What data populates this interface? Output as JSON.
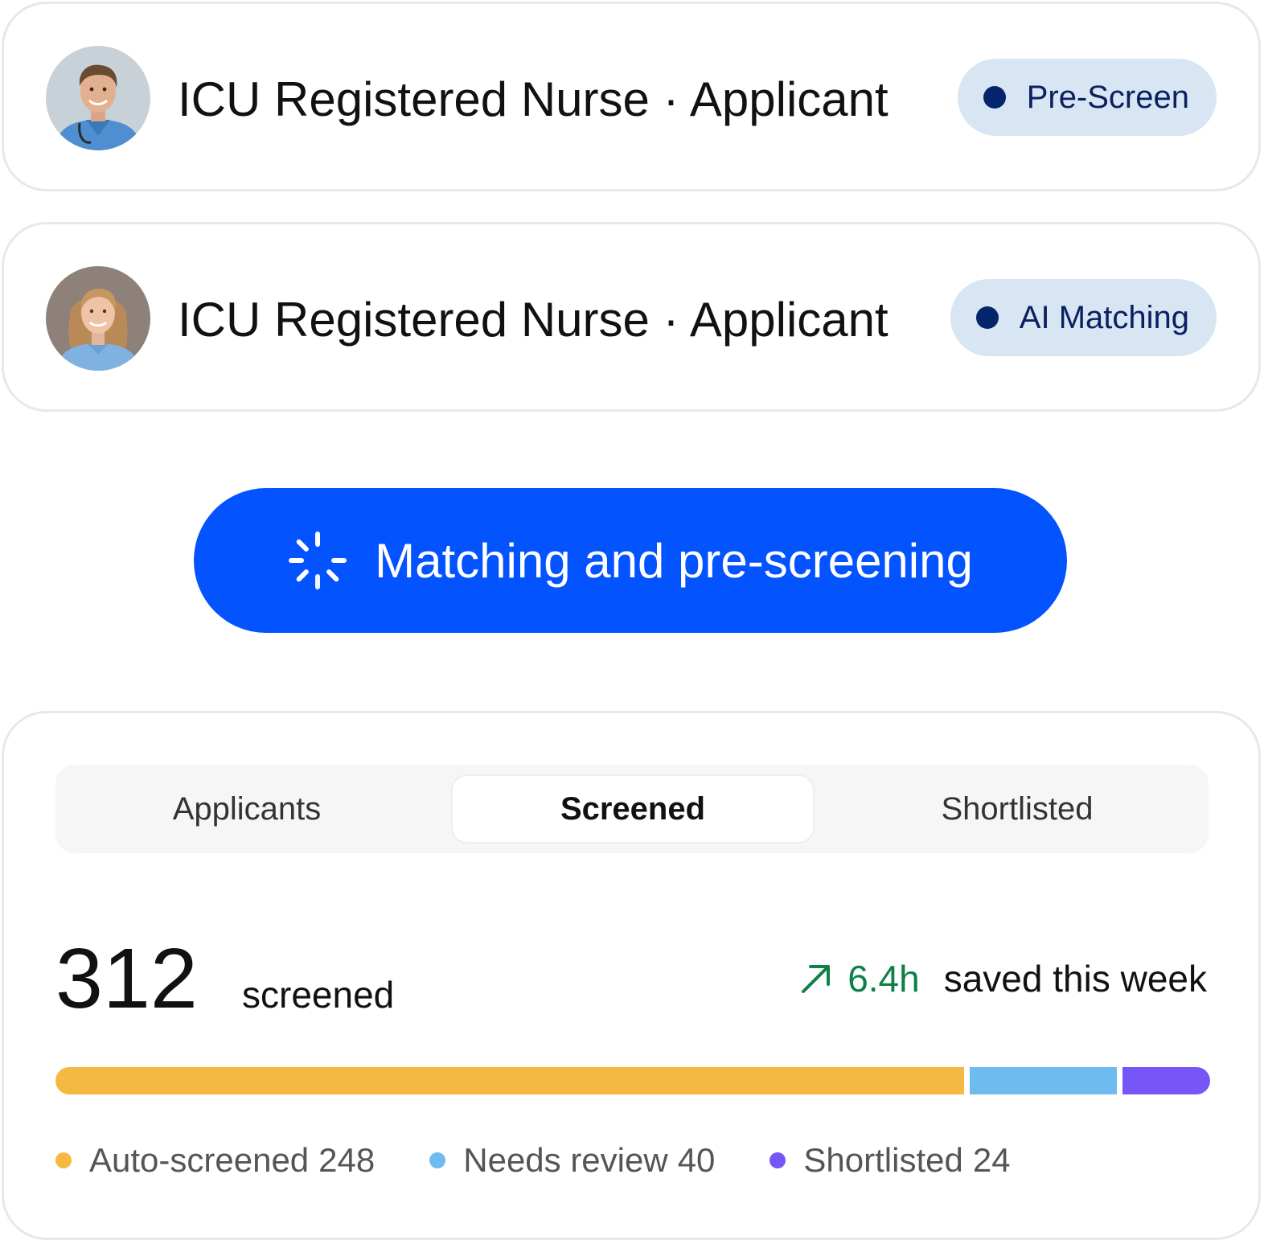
{
  "applicants": [
    {
      "title": "ICU Registered Nurse · Applicant",
      "status": "Pre-Screen",
      "avatar_icon": "male-nurse-avatar"
    },
    {
      "title": "ICU Registered Nurse · Applicant",
      "status": "AI Matching",
      "avatar_icon": "female-nurse-avatar"
    }
  ],
  "cta": {
    "label": "Matching and pre-screening",
    "icon": "loading-spinner-icon"
  },
  "stats": {
    "tabs": [
      "Applicants",
      "Screened",
      "Shortlisted"
    ],
    "active_tab": "Screened",
    "count": "312",
    "count_label": "screened",
    "saved_icon": "trend-up-arrow-icon",
    "saved_value": "6.4h",
    "saved_label": "saved this week",
    "breakdown": [
      {
        "label": "Auto-screened",
        "value": "248",
        "color": "#F5B942"
      },
      {
        "label": "Needs review",
        "value": "40",
        "color": "#6EBBEF"
      },
      {
        "label": "Shortlisted",
        "value": "24",
        "color": "#7656F7"
      }
    ]
  },
  "colors": {
    "primary": "#0353FF",
    "pill_bg": "#D7E6F2",
    "pill_text": "#0B2060",
    "pill_dot": "#04246B",
    "positive": "#0F8048"
  }
}
